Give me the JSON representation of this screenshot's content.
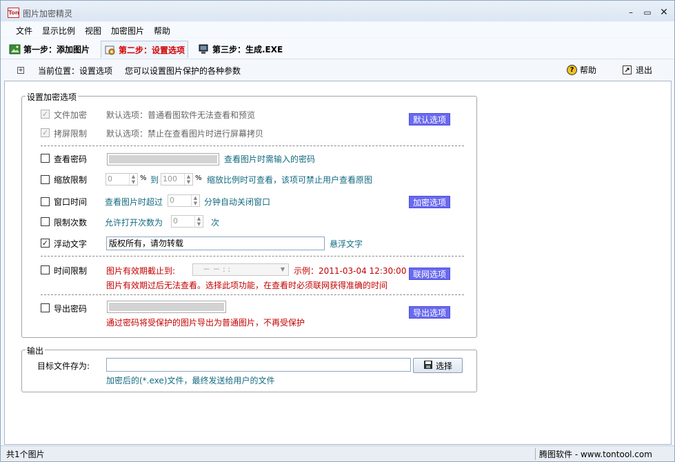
{
  "window": {
    "title": "图片加密精灵",
    "icon_text": "Ton",
    "min_glyph": "–",
    "max_glyph": "▭",
    "close_glyph": "✕"
  },
  "menu": [
    "文件",
    "显示比例",
    "视图",
    "加密图片",
    "帮助"
  ],
  "toolbar": {
    "step1": "第一步：添加图片",
    "step2": "第二步：设置选项",
    "step3": "第三步：生成.EXE"
  },
  "infobar": {
    "location_label": "当前位置：设置选项",
    "description": "您可以设置图片保护的各种参数",
    "help": "帮助",
    "exit": "退出",
    "expand_glyph": "+"
  },
  "encrypt_options": {
    "legend": "设置加密选项",
    "file_encrypt": {
      "label": "文件加密",
      "checked": true,
      "desc": "默认选项：普通看图软件无法查看和预览"
    },
    "screen_limit": {
      "label": "拷屏限制",
      "checked": true,
      "desc": "默认选项：禁止在查看图片时进行屏幕拷贝"
    },
    "default_btn": "默认选项",
    "view_password": {
      "label": "查看密码",
      "hint": "查看图片时需输入的密码"
    },
    "zoom_limit": {
      "label": "缩放限制",
      "from": "0",
      "percent1": "%",
      "to_label": "到",
      "to": "100",
      "percent2": "%",
      "hint": "缩放比例时可查看，该项可禁止用户查看原图"
    },
    "window_time": {
      "label": "窗口时间",
      "prefix": "查看图片时超过",
      "value": "0",
      "suffix": "分钟自动关闭窗口"
    },
    "encrypt_btn": "加密选项",
    "limit_count": {
      "label": "限制次数",
      "prefix": "允许打开次数为",
      "value": "0",
      "suffix": "次"
    },
    "float_text": {
      "label": "浮动文字",
      "value": "版权所有，请勿转载",
      "hint": "悬浮文字",
      "checked": true
    },
    "time_limit": {
      "label": "时间限制",
      "prefix": "图片有效期截止到:",
      "combo": "－  －    :  :",
      "example": "示例：2011-03-04 12:30:00",
      "note": "图片有效期过后无法查看。选择此项功能，在查看时必须联网获得准确的时间"
    },
    "network_btn": "联网选项",
    "export_password": {
      "label": "导出密码",
      "note": "通过密码将受保护的图片导出为普通图片，不再受保护"
    },
    "export_btn": "导出选项"
  },
  "output": {
    "legend": "输出",
    "target_label": "目标文件存为:",
    "target_value": "",
    "select_btn": "选择",
    "hint": "加密后的(*.exe)文件，最终发送给用户的文件"
  },
  "status": {
    "left": "共1个图片",
    "right": "腾图软件 - www.tontool.com"
  },
  "colors": {
    "accent_red": "#c40000",
    "teal_text": "#136a80",
    "blue_button": "#6a6af0"
  },
  "icons": {
    "step1": "add-image-icon",
    "step2": "settings-icon",
    "step3": "build-exe-icon",
    "help": "help-icon",
    "exit": "exit-icon",
    "select": "save-disk-icon"
  }
}
